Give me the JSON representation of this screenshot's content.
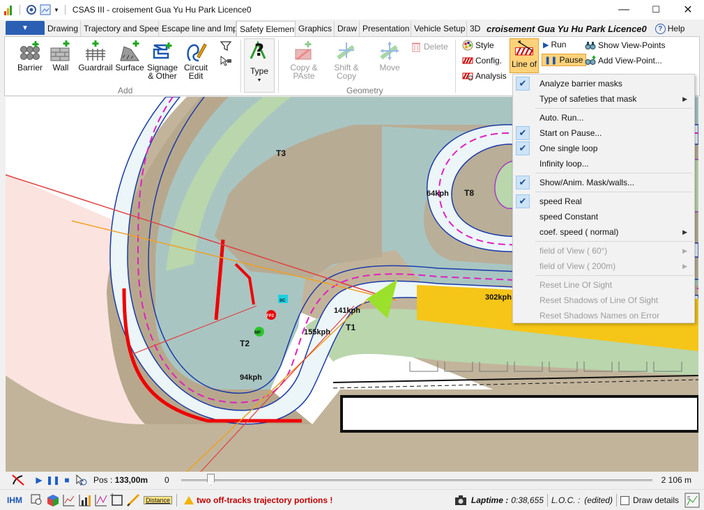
{
  "window": {
    "title": "CSAS III - croisement Gua Yu Hu Park Licence0",
    "minimize": "—",
    "maximize": "☐",
    "close": "✕"
  },
  "tabs": [
    {
      "label": "Drawing"
    },
    {
      "label": "Trajectory and Spee"
    },
    {
      "label": "Escape line and Imp"
    },
    {
      "label": "Safety Element",
      "active": true
    },
    {
      "label": "Graphics"
    },
    {
      "label": "Draw"
    },
    {
      "label": "Presentation"
    },
    {
      "label": "Vehicle Setup"
    },
    {
      "label": "3D"
    }
  ],
  "project_title": "croisement Gua Yu Hu Park Licence0",
  "help_label": "Help",
  "ribbon": {
    "add": {
      "label": "Add",
      "barrier": "Barrier",
      "wall": "Wall",
      "guardrail": "Guardrail",
      "surface": "Surface",
      "signage_1": "Signage",
      "signage_2": "& Other",
      "circuit_1": "Circuit",
      "circuit_2": "Edit"
    },
    "type_label": "Type",
    "geometry": {
      "label": "Geometry",
      "copy_1": "Copy &",
      "copy_2": "PAste",
      "shift_1": "Shift &",
      "shift_2": "Copy",
      "move": "Move",
      "delete": "Delete"
    },
    "style": "Style",
    "config": "Config.",
    "analysis": "Analysis",
    "line_of_sight": "Line of",
    "run": "Run",
    "pause": "Pause",
    "show_view_points": "Show View-Points",
    "add_view_point": "Add View-Point..."
  },
  "map": {
    "labels": {
      "t3": "T3",
      "t8": "T8",
      "t2": "T2",
      "t1": "T1",
      "s64": "64kph",
      "s141": "141kph",
      "s155": "155kph",
      "s94": "94kph",
      "s302": "302kph",
      "sc": "SC",
      "fp2": "FP2",
      "mp": "MP"
    }
  },
  "menu": {
    "items": [
      {
        "label": "Analyze barrier masks",
        "checked": true
      },
      {
        "label": "Type of safeties that mask",
        "submenu": true
      },
      {
        "label": "Auto. Run..."
      },
      {
        "label": "Start on Pause...",
        "checked": true
      },
      {
        "label": "One single loop",
        "checked": true
      },
      {
        "label": "Infinity loop..."
      },
      {
        "label": "Show/Anim. Mask/walls...",
        "checked": true
      },
      {
        "label": "speed Real",
        "checked": true
      },
      {
        "label": "speed Constant"
      },
      {
        "label": "coef. speed ( normal)",
        "submenu": true
      },
      {
        "label": "field of View ( 60°)",
        "disabled": true,
        "submenu": true
      },
      {
        "label": "field of View ( 200m)",
        "disabled": true,
        "submenu": true
      },
      {
        "label": "Reset Line Of Sight",
        "disabled": true
      },
      {
        "label": "Reset Shadows of Line Of Sight",
        "disabled": true
      },
      {
        "label": "Reset Shadows Names on Error",
        "disabled": true
      }
    ]
  },
  "playback": {
    "pos_prefix": "Pos : ",
    "pos_value": "133,00m",
    "start": "0",
    "end": "2 106 m",
    "progress": 0.063
  },
  "status": {
    "ihm": "IHM",
    "distance": "Distance",
    "warning": "two off-tracks trajectory portions !",
    "laptime_label": "Laptime :",
    "laptime_value": "0:38,655",
    "loc_label": "L.O.C. :",
    "edited": "(edited)",
    "draw_details": "Draw details"
  },
  "colors": {
    "accent": "#2b5fb4",
    "warning": "#c00000",
    "pause_bg": "#ffd27a"
  }
}
